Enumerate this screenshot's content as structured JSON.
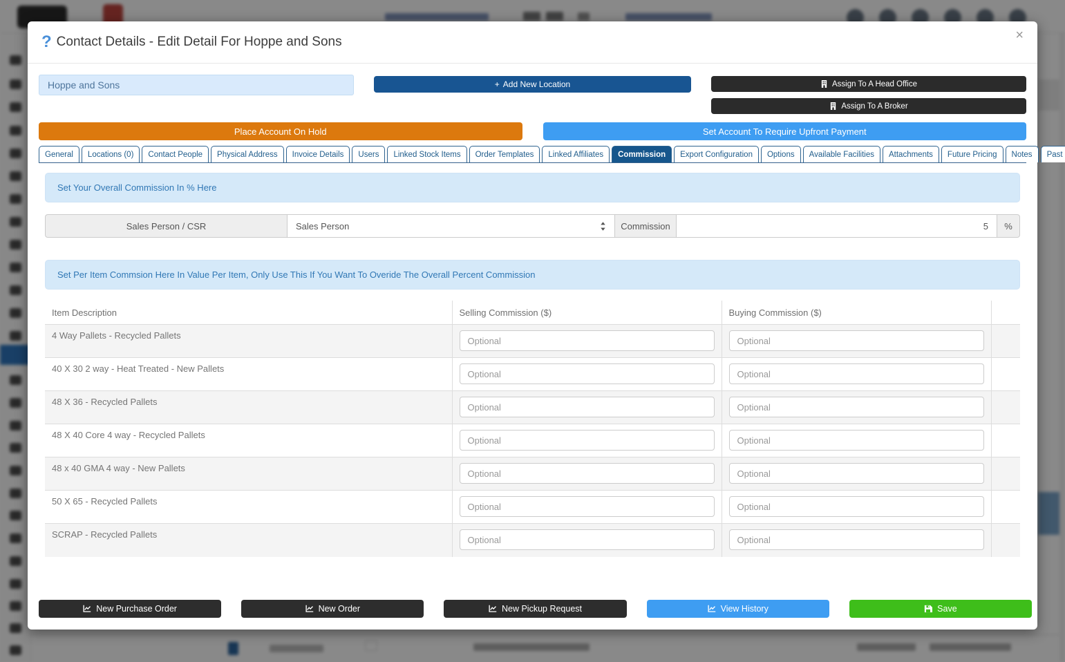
{
  "modal": {
    "help_icon": "?",
    "title": "Contact Details - Edit Detail For Hoppe and Sons",
    "close_icon": "×"
  },
  "header_actions": {
    "account_name": "Hoppe and Sons",
    "add_new_location_icon": "+",
    "add_new_location": "Add New Location",
    "assign_head_office": "Assign To A Head Office",
    "assign_broker": "Assign To A Broker",
    "place_account_on_hold": "Place Account On Hold",
    "set_upfront_payment": "Set Account To Require Upfront Payment"
  },
  "tabs": [
    {
      "label": "General",
      "active": false
    },
    {
      "label": "Locations (0)",
      "active": false
    },
    {
      "label": "Contact People",
      "active": false
    },
    {
      "label": "Physical Address",
      "active": false
    },
    {
      "label": "Invoice Details",
      "active": false
    },
    {
      "label": "Users",
      "active": false
    },
    {
      "label": "Linked Stock Items",
      "active": false
    },
    {
      "label": "Order Templates",
      "active": false
    },
    {
      "label": "Linked Affiliates",
      "active": false
    },
    {
      "label": "Commission",
      "active": true
    },
    {
      "label": "Export Configuration",
      "active": false
    },
    {
      "label": "Options",
      "active": false
    },
    {
      "label": "Available Facilities",
      "active": false
    },
    {
      "label": "Attachments",
      "active": false
    },
    {
      "label": "Future Pricing",
      "active": false
    },
    {
      "label": "Notes",
      "active": false
    },
    {
      "label": "Past Due Payments",
      "active": false
    }
  ],
  "overall_commission": {
    "banner": "Set Your Overall Commission In % Here",
    "role_label": "Sales Person / CSR",
    "role_selected": "Sales Person",
    "commission_label": "Commission",
    "commission_value": "5",
    "unit": "%"
  },
  "per_item_commission": {
    "banner": "Set Per Item Commsion Here In Value Per Item, Only Use This If You Want To Overide The Overall Percent Commission",
    "columns": [
      "Item Description",
      "Selling Commission ($)",
      "Buying Commission ($)"
    ],
    "input_placeholder": "Optional",
    "items": [
      "4 Way Pallets - Recycled Pallets",
      "40 X 30 2 way - Heat Treated - New Pallets",
      "48 X 36 - Recycled Pallets",
      "48 X 40 Core 4 way - Recycled Pallets",
      "48 x 40 GMA 4 way - New Pallets",
      "50 X 65 - Recycled Pallets",
      "SCRAP - Recycled Pallets"
    ]
  },
  "footer_buttons": [
    {
      "label": "New Purchase Order",
      "style": "dark",
      "icon": "chart-line"
    },
    {
      "label": "New Order",
      "style": "dark",
      "icon": "chart-line"
    },
    {
      "label": "New Pickup Request",
      "style": "dark",
      "icon": "chart-line"
    },
    {
      "label": "View History",
      "style": "blue",
      "icon": "chart-line"
    },
    {
      "label": "Save",
      "style": "green",
      "icon": "save"
    }
  ],
  "colors": {
    "accent_dark_blue": "#185592",
    "accent_orange": "#dc790e",
    "accent_blue": "#3e9df2",
    "accent_green": "#3ebe1a",
    "tab_active_bg": "#16568c",
    "banner_bg": "#d5e9f9",
    "banner_text": "#3178b5"
  }
}
